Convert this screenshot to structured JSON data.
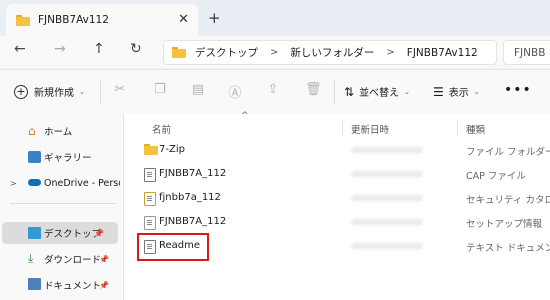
{
  "window": {
    "tab_title": "FJNBB7Av112",
    "tab_close": "✕",
    "new_tab": "+"
  },
  "nav": {
    "back": "←",
    "forward": "→",
    "up": "↑",
    "refresh": "↻",
    "breadcrumbs": [
      "デスクトップ",
      "新しいフォルダー",
      "FJNBB7Av112"
    ],
    "separator": ">",
    "search_text": "FJNBB"
  },
  "toolbar": {
    "new_label": "新規作成",
    "sort_label": "並べ替え",
    "view_label": "表示",
    "more": "•••",
    "icons": [
      "cut-icon",
      "copy-icon",
      "paste-icon",
      "rename-icon",
      "share-icon",
      "delete-icon"
    ]
  },
  "sidebar": {
    "items": [
      {
        "label": "ホーム",
        "icon": "home-icon"
      },
      {
        "label": "ギャラリー",
        "icon": "gallery-icon"
      },
      {
        "label": "OneDrive - Perso",
        "icon": "cloud-icon"
      },
      {
        "label": "デスクトップ",
        "icon": "desktop-icon"
      },
      {
        "label": "ダウンロード",
        "icon": "download-icon"
      },
      {
        "label": "ドキュメント",
        "icon": "document-icon"
      }
    ]
  },
  "columns": {
    "name": "名前",
    "date": "更新日時",
    "type": "種類"
  },
  "files": [
    {
      "name": "7-Zip",
      "type": "ファイル フォルダー",
      "icon": "folder-icon"
    },
    {
      "name": "FJNBB7A_112",
      "type": "CAP ファイル",
      "icon": "cap-file-icon"
    },
    {
      "name": "fjnbb7a_112",
      "type": "セキュリティ カタログ",
      "icon": "security-catalog-icon"
    },
    {
      "name": "FJNBB7A_112",
      "type": "セットアップ情報",
      "icon": "setup-info-icon"
    },
    {
      "name": "Readme",
      "type": "テキスト ドキュメント",
      "icon": "text-document-icon"
    }
  ],
  "colors": {
    "highlight": "#d71a1a",
    "folder": "#f4c140",
    "onedrive": "#0f6cbd"
  }
}
